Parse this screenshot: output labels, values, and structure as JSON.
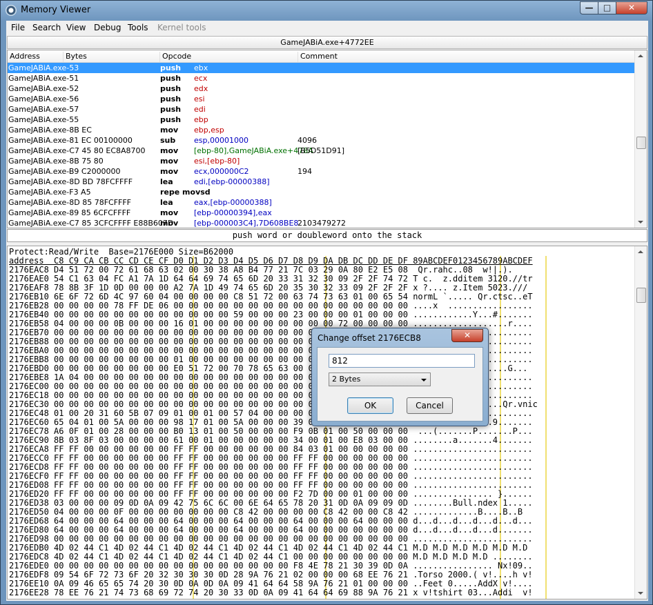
{
  "window": {
    "title": "Memory Viewer",
    "close": "✕",
    "max": "□",
    "min": "—"
  },
  "menu": [
    "File",
    "Search",
    "View",
    "Debug",
    "Tools",
    "Kernel tools"
  ],
  "address_bar": "GameJABiA.exe+4772EE",
  "disasm": {
    "columns": [
      "Address",
      "Bytes",
      "Opcode",
      "Comment"
    ],
    "rows": [
      {
        "addr": "GameJABiA.exe-53",
        "op": "push",
        "arg": "ebx",
        "cmt": ""
      },
      {
        "addr": "GameJABiA.exe-51",
        "op": "push",
        "arg": "ecx",
        "cmt": ""
      },
      {
        "addr": "GameJABiA.exe-52",
        "op": "push",
        "arg": "edx",
        "cmt": ""
      },
      {
        "addr": "GameJABiA.exe-56",
        "op": "push",
        "arg": "esi",
        "cmt": ""
      },
      {
        "addr": "GameJABiA.exe-57",
        "op": "push",
        "arg": "edi",
        "cmt": ""
      },
      {
        "addr": "GameJABiA.exe-55",
        "op": "push",
        "arg": "ebp",
        "cmt": ""
      },
      {
        "addr": "GameJABiA.exe-8B EC",
        "op": "mov",
        "arg": "ebp,esp",
        "cmt": ""
      },
      {
        "addr": "GameJABiA.exe-81 EC 00100000",
        "op": "sub",
        "arg": "esp,00001000",
        "cmt": "4096"
      },
      {
        "addr": "GameJABiA.exe-C7 45 80 EC8A8700",
        "op": "mov",
        "arg": "[ebp-80],GameJABiA.exe+478A",
        "cmt": "[B5D51D91]"
      },
      {
        "addr": "GameJABiA.exe-8B 75 80",
        "op": "mov",
        "arg": "esi,[ebp-80]",
        "cmt": ""
      },
      {
        "addr": "GameJABiA.exe-B9 C2000000",
        "op": "mov",
        "arg": "ecx,000000C2",
        "cmt": "194"
      },
      {
        "addr": "GameJABiA.exe-8D BD 78FCFFFF",
        "op": "lea",
        "arg": "edi,[ebp-00000388]",
        "cmt": ""
      },
      {
        "addr": "GameJABiA.exe-F3 A5",
        "op": "repe movsd",
        "arg": "",
        "cmt": ""
      },
      {
        "addr": "GameJABiA.exe-8D 85 78FCFFFF",
        "op": "lea",
        "arg": "eax,[ebp-00000388]",
        "cmt": ""
      },
      {
        "addr": "GameJABiA.exe-89 85 6CFCFFFF",
        "op": "mov",
        "arg": "[ebp-00000394],eax",
        "cmt": ""
      },
      {
        "addr": "GameJABiA.exe-C7 85 3CFCFFFF E88B607D",
        "op": "mov",
        "arg": "[ebp-000003C4],7D608BE8",
        "cmt": "2103479272"
      }
    ]
  },
  "opcode_description": "push word or doubleword onto the stack",
  "hex": {
    "info": "Protect:Read/Write  Base=2176E000 Size=B62000",
    "header": "address  C8 C9 CA CB CC CD CE CF D0 D1 D2 D3 D4 D5 D6 D7 D8 D9 DA DB DC DD DE DF 89ABCDEF0123456789ABCDEF",
    "lines": [
      "2176EAC8 D4 51 72 00 72 61 68 63 02 00 30 38 A8 B4 77 21 7C 03 29 0A 80 E2 E5 08  Qr.rahc..08  w!|.).",
      "2176EAE0 54 C1 63 04 FC A1 7A 1D 64 64 69 74 65 6D 20 33 31 32 30 09 2F 2F 74 72 T c.  z.dditem 3120.//tr",
      "2176EAF8 78 8B 3F 1D 0D 00 00 00 A2 7A 1D 49 74 65 6D 20 35 30 32 33 09 2F 2F 2F x ?.... z.Item 5023.///",
      "2176EB10 6E 6F 72 6D 4C 97 60 04 00 00 00 00 C8 51 72 00 63 74 73 63 01 00 65 54 normL `..... Qr.ctsc..eT",
      "2176EB28 00 00 00 00 78 FF DE 06 00 00 00 00 00 00 00 00 00 00 00 00 00 00 00 00 ....x  .................",
      "2176EB40 00 00 00 00 00 00 00 00 00 00 00 00 59 00 00 00 23 00 00 00 01 00 00 00 ............Y...#.......",
      "2176EB58 04 00 00 00 0B 00 00 00 16 01 00 00 00 00 00 00 00 00 00 72 00 00 00 00 ...................r....",
      "2176EB70 00 00 00 00 00 00 00 00 00 00 00 00 00 00 00 00 00 00 00 00 00 00 00 00 ........................",
      "2176EB88 00 00 00 00 00 00 00 00 00 00 00 00 00 00 00 00 00 00 00 00 00 00 00 00 ........................",
      "2176EBA0 00 00 00 00 00 00 00 00 00 00 00 00 00 00 00 00 00 00 00 00 00 00 00 00 ........................",
      "2176EBB8 00 00 00 00 00 00 00 00 01 00 00 00 00 00 00 00 00 00 00 00 00 00 00 00 ........................",
      "2176EBD0 00 00 00 00 00 00 00 00 E0 51 72 00 70 78 65 63 00 00 00 00 47 00 00 00 ....... Qr.pxec....G...",
      "2176EBE8 1A 04 00 00 00 00 00 00 00 00 00 00 00 00 00 00 00 00 00 00 00 00 00 00 ........................",
      "2176EC00 00 00 00 00 00 00 00 00 00 00 00 00 00 00 00 00 00 00 00 00 00 00 00 00 ........................",
      "2176EC18 00 00 00 00 00 00 00 00 00 00 00 00 00 00 00 00 00 00 00 00 00 00 00 00 ........................",
      "2176EC30 00 00 00 00 00 00 00 00 00 00 00 00 00 00 00 00 00 00 00 00 72 76 6E 69 63 ...............Qr.vnic",
      "2176EC48 01 00 20 31 60 5B 07 09 01 00 01 00 57 04 00 00 00 00 00 00 00 00 00 00 .. 1`[......W...........",
      "2176EC60 65 04 01 00 5A 00 00 00 98 17 01 00 5A 00 00 00 39 00 00 00 00 00 00 00 e...Z.......Z...9.......",
      "2176EC78 A6 0F 01 00 28 00 00 00 B0 13 01 00 50 00 00 00 F9 0B 01 00 50 00 00 00  ...(.......P.......P...",
      "2176EC90 8B 03 8F 03 00 00 00 00 61 00 01 00 00 00 00 00 34 00 01 00 E8 03 00 00 ........a.......4.......",
      "2176ECA8 FF FF 00 00 00 00 00 00 FF FF 00 00 00 00 00 00 84 03 01 00 00 00 00 00 ........................",
      "2176ECC0 FF FF 00 00 00 00 00 00 FF FF 00 00 00 00 00 00 FF FF 00 00 00 00 00 00 ........................",
      "2176ECD8 FF FF 00 00 00 00 00 00 FF FF 00 00 00 00 00 00 FF FF 00 00 00 00 00 00 ........................",
      "2176ECF0 FF FF 00 00 00 00 00 00 FF FF 00 00 00 00 00 00 FF FF 00 00 00 00 00 00 ........................",
      "2176ED08 FF FF 00 00 00 00 00 00 FF FF 00 00 00 00 00 00 FF FF 00 00 00 00 00 00 ........................",
      "2176ED20 FF FF 00 00 00 00 00 00 FF FF 00 00 00 00 00 00 F2 7D 00 00 01 00 00 00 ................ }......",
      "2176ED38 03 00 00 00 09 0D 0A 09 42 75 6C 6C 00 6E 64 65 78 20 31 0D 0A 09 09 0D ........Bull.ndex 1.....",
      "2176ED50 04 00 00 00 0F 00 00 00 00 00 00 00 C8 42 00 00 00 00 C8 42 00 00 C8 42 .............B....B..B",
      "2176ED68 64 00 00 00 64 00 00 00 64 00 00 00 64 00 00 00 64 00 00 00 64 00 00 00 d...d...d...d...d...d...",
      "2176ED80 64 00 00 00 64 00 00 00 64 00 00 00 64 00 00 00 64 00 00 00 00 00 00 00 d...d...d...d...d.......",
      "2176ED98 00 00 00 00 00 00 00 00 00 00 00 00 00 00 00 00 00 00 00 00 00 00 00 00 ........................",
      "2176EDB0 4D 02 44 C1 4D 02 44 C1 4D 02 44 C1 4D 02 44 C1 4D 02 44 C1 4D 02 44 C1 M.D M.D M.D M.D M.D M.D ",
      "2176EDC8 4D 02 44 C1 4D 02 44 C1 4D 02 44 C1 4D 02 44 C1 00 00 00 00 00 00 00 00 M.D M.D M.D M.D ........",
      "2176EDE0 00 00 00 00 00 00 00 00 00 00 00 00 00 00 00 00 F8 4E 78 21 30 39 0D 0A ................ Nx!09..",
      "2176EDF8 09 54 6F 72 73 6F 20 32 30 30 30 0D 28 9A 76 21 02 00 00 00 68 EE 76 21 .Torso 2000.( v!....h v!",
      "2176EE10 0A 09 46 65 65 74 20 30 0D 0A 0D 0A 09 41 64 64 58 9A 76 21 01 00 00 00 ..Feet 0.....AddX v!....",
      "2176EE28 78 EE 76 21 74 73 68 69 72 74 20 30 33 0D 0A 09 41 64 64 69 88 9A 76 21 x v!tshirt 03...Addi  v!"
    ]
  },
  "dialog": {
    "title": "Change offset 2176ECB8",
    "close": "✕",
    "value": "812",
    "type": "2 Bytes",
    "ok": "OK",
    "cancel": "Cancel"
  },
  "colors": {
    "selection": "#3399ff",
    "register": "#c00000",
    "highlight": "#f0e070"
  }
}
